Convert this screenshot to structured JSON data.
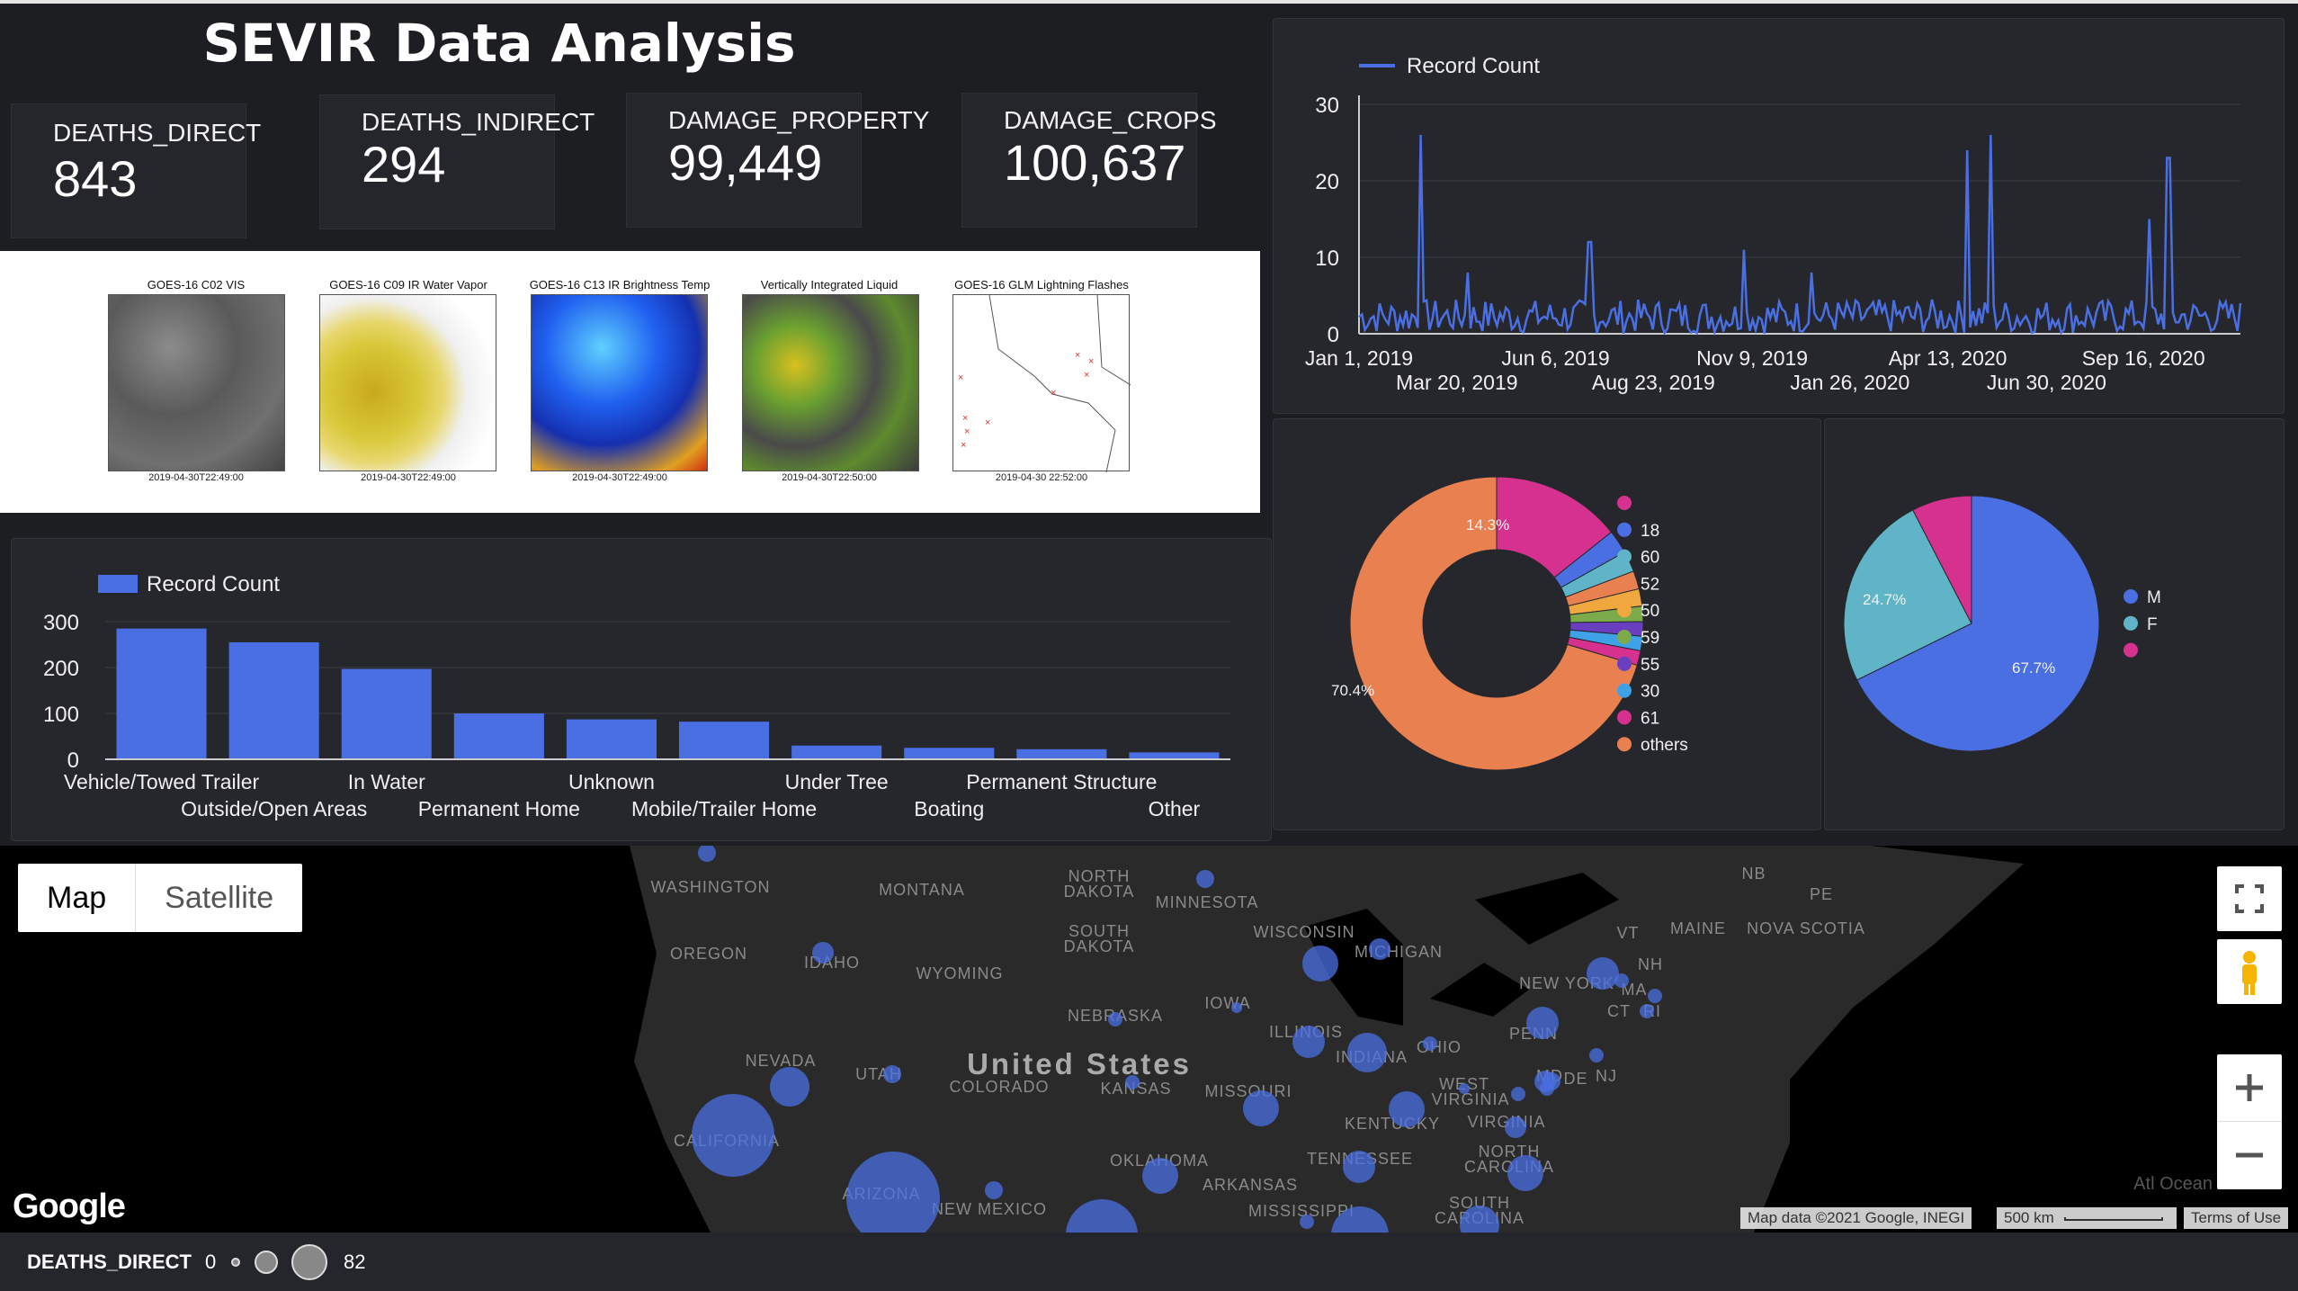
{
  "title": "SEVIR Data Analysis",
  "kpis": [
    {
      "label": "DEATHS_DIRECT",
      "value": "843"
    },
    {
      "label": "DEATHS_INDIRECT",
      "value": "294"
    },
    {
      "label": "DAMAGE_PROPERTY",
      "value": "99,449"
    },
    {
      "label": "DAMAGE_CROPS",
      "value": "100,637"
    }
  ],
  "images": [
    {
      "title": "GOES-16 C02 VIS",
      "time": "2019-04-30T22:49:00"
    },
    {
      "title": "GOES-16 C09 IR Water Vapor",
      "time": "2019-04-30T22:49:00"
    },
    {
      "title": "GOES-16 C13 IR Brightness Temp",
      "time": "2019-04-30T22:49:00"
    },
    {
      "title": "Vertically Integrated Liquid",
      "time": "2019-04-30T22:50:00"
    },
    {
      "title": "GOES-16 GLM Lightning Flashes",
      "time": "2019-04-30 22:52:00"
    }
  ],
  "chart_data": [
    {
      "type": "line",
      "legend": "Record Count",
      "ylim": [
        0,
        30
      ],
      "yticks": [
        "0",
        "10",
        "20",
        "30"
      ],
      "xticks_top": [
        "Jan 1, 2019",
        "Jun 6, 2019",
        "Nov 9, 2019",
        "Apr 13, 2020",
        "Sep 16, 2020"
      ],
      "xticks_bottom": [
        "Mar 20, 2019",
        "Aug 23, 2019",
        "Jan 26, 2020",
        "Jun 30, 2020"
      ],
      "x_range": [
        "2019-01-01",
        "2020-10-31"
      ],
      "peaks": [
        {
          "date": "2019-02-17",
          "value": 26
        },
        {
          "date": "2019-03-25",
          "value": 8
        },
        {
          "date": "2019-06-25",
          "value": 12
        },
        {
          "date": "2019-10-20",
          "value": 11
        },
        {
          "date": "2020-04-06",
          "value": 24
        },
        {
          "date": "2020-04-24",
          "value": 26
        },
        {
          "date": "2020-08-23",
          "value": 15
        },
        {
          "date": "2020-09-06",
          "value": 23
        },
        {
          "date": "2019-12-10",
          "value": 8
        }
      ],
      "color": "#4a6fe3"
    },
    {
      "type": "bar",
      "legend": "Record Count",
      "categories": [
        "Vehicle/Towed Trailer",
        "Outside/Open Areas",
        "In Water",
        "Permanent Home",
        "Unknown",
        "Mobile/Trailer Home",
        "Under Tree",
        "Boating",
        "Permanent Structure",
        "Other"
      ],
      "values": [
        285,
        255,
        197,
        100,
        87,
        82,
        30,
        25,
        22,
        15
      ],
      "ylim": [
        0,
        300
      ],
      "yticks": [
        "0",
        "100",
        "200",
        "300"
      ],
      "color": "#4a6fe3"
    },
    {
      "type": "pie",
      "subtype": "donut",
      "labels": [
        "",
        "18",
        "60",
        "52",
        "50",
        "59",
        "55",
        "30",
        "61",
        "others"
      ],
      "values": [
        14.3,
        2.6,
        2.3,
        2.0,
        1.9,
        1.7,
        1.6,
        1.6,
        1.6,
        70.4
      ],
      "colors": [
        "#d6318f",
        "#4a6fe3",
        "#5fb5c7",
        "#e8804f",
        "#f0a73d",
        "#7cab4a",
        "#6a3fbf",
        "#3fa1e6",
        "#d6318f",
        "#e8804f"
      ],
      "labeled_pct": [
        "14.3%",
        "70.4%"
      ]
    },
    {
      "type": "pie",
      "labels": [
        "M",
        "F",
        ""
      ],
      "values": [
        67.7,
        24.7,
        7.6
      ],
      "colors": [
        "#4a6fe3",
        "#5fb5c7",
        "#d6318f"
      ],
      "labeled_pct": [
        "67.7%",
        "24.7%"
      ]
    }
  ],
  "map": {
    "toggle": [
      "Map",
      "Satellite"
    ],
    "country_label": "United States",
    "states": [
      "WASHINGTON",
      "MONTANA",
      "NORTH DAKOTA",
      "MINNESOTA",
      "OREGON",
      "IDAHO",
      "WYOMING",
      "SOUTH DAKOTA",
      "WISCONSIN",
      "MICHIGAN",
      "NEBRASKA",
      "IOWA",
      "ILLINOIS",
      "INDIANA",
      "OHIO",
      "PENN",
      "NEW YORK",
      "NEVADA",
      "UTAH",
      "COLORADO",
      "KANSAS",
      "MISSOURI",
      "KENTUCKY",
      "WEST VIRGINIA",
      "VIRGINIA",
      "CALIFORNIA",
      "OKLAHOMA",
      "ARKANSAS",
      "TENNESSEE",
      "NORTH CAROLINA",
      "SOUTH CAROLINA",
      "ARIZONA",
      "NEW MEXICO",
      "MISSISSIPPI",
      "MAINE",
      "NOVA SCOTIA",
      "NB",
      "PE",
      "VT",
      "NH",
      "MA",
      "CT",
      "RI",
      "MD",
      "DE",
      "NJ"
    ],
    "google": "Google",
    "attribution": "Map data ©2021 Google, INEGI",
    "scale": "500 km",
    "terms": "Terms of Use",
    "ocean": "Atl Ocean"
  },
  "size_legend": {
    "field": "DEATHS_DIRECT",
    "min": "0",
    "max": "82"
  }
}
